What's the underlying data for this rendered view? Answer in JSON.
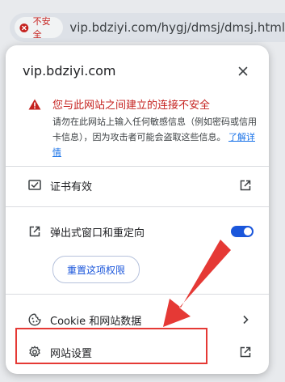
{
  "address_bar": {
    "security_label": "不安全",
    "url": "vip.bdziyi.com/hygj/dmsj/dmsj.html"
  },
  "popup": {
    "site": "vip.bdziyi.com",
    "warning": {
      "title": "您与此网站之间建立的连接不安全",
      "body": "请勿在此网站上输入任何敏感信息（例如密码或信用卡信息），因为攻击者可能会盗取这些信息。",
      "learn_more": "了解详情"
    },
    "certificate_label": "证书有效",
    "popups_label": "弹出式窗口和重定向",
    "popups_enabled": true,
    "reset_label": "重置这项权限",
    "cookie_label": "Cookie 和网站数据",
    "site_settings_label": "网站设置"
  },
  "colors": {
    "danger": "#c5221f",
    "accent": "#1a56db",
    "annotation": "#e53935"
  },
  "icons": {
    "insecure": "warning-circle-icon",
    "close": "close-icon",
    "warning": "warning-triangle-icon",
    "certificate": "certificate-icon",
    "external": "open-external-icon",
    "popups": "popup-redirect-icon",
    "cookie": "cookie-icon",
    "chevron": "chevron-right-icon",
    "settings": "gear-icon"
  }
}
